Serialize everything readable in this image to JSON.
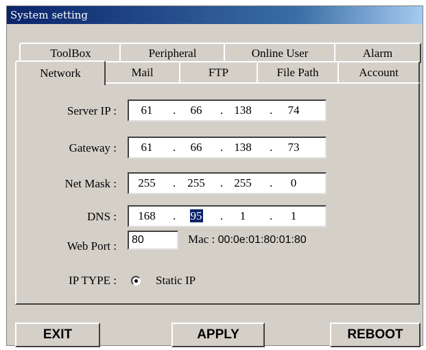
{
  "window": {
    "title": "System setting"
  },
  "tabs": {
    "row1": [
      "ToolBox",
      "Peripheral",
      "Online User",
      "Alarm"
    ],
    "row2": [
      "Network",
      "Mail",
      "FTP",
      "File Path",
      "Account"
    ],
    "active": "Network"
  },
  "network": {
    "server_ip": {
      "label": "Server IP :",
      "octets": [
        "61",
        "66",
        "138",
        "74"
      ]
    },
    "gateway": {
      "label": "Gateway :",
      "octets": [
        "61",
        "66",
        "138",
        "73"
      ]
    },
    "net_mask": {
      "label": "Net Mask :",
      "octets": [
        "255",
        "255",
        "255",
        "0"
      ]
    },
    "dns": {
      "label": "DNS :",
      "octets": [
        "168",
        "95",
        "1",
        "1"
      ],
      "selected_octet": 2
    },
    "dot": ".",
    "web_port": {
      "label": "Web Port :",
      "value": "80"
    },
    "mac": {
      "label": "Mac :",
      "value": "00:0e:01:80:01:80"
    },
    "ip_type": {
      "label": "IP TYPE :",
      "option": "Static IP"
    }
  },
  "buttons": {
    "exit": "EXIT",
    "apply": "APPLY",
    "reboot": "REBOOT"
  },
  "colors": {
    "window_bg": "#d4d0c8",
    "titlebar": "#0a246a",
    "selection": "#0a246a"
  }
}
